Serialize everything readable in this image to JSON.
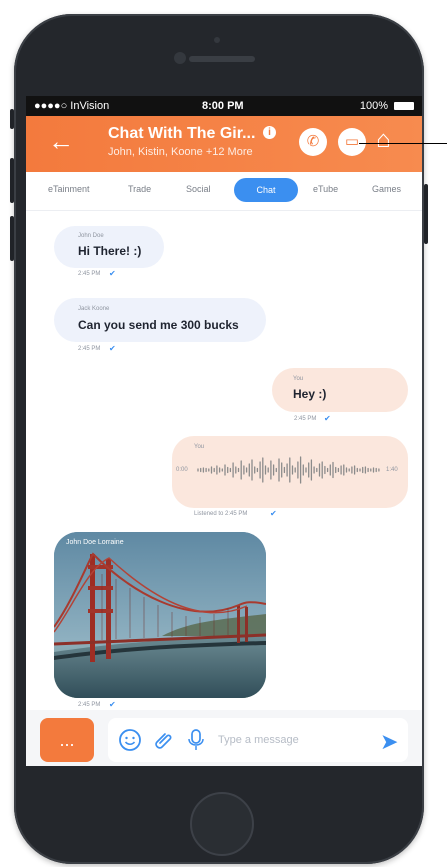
{
  "status": {
    "carrier": "●●●●○ InVision",
    "time": "8:00 PM",
    "battery": "100%"
  },
  "header": {
    "back": "←",
    "title": "Chat With The Gir...",
    "info": "i",
    "subtitle": "John, Kistin, Koone +12 More",
    "call_icon": "phone-icon",
    "video_icon": "video-icon",
    "home_icon": "home-icon"
  },
  "tabs": [
    "eTainment",
    "Trade",
    "Social",
    "Chat",
    "eTube",
    "Games"
  ],
  "messages": [
    {
      "sender": "John Doe",
      "text": "Hi There! :)",
      "time": "2:45 PM",
      "status": "✔"
    },
    {
      "sender": "Jack Koone",
      "text": "Can you send me 300 bucks",
      "time": "2:45 PM",
      "status": "✔"
    },
    {
      "sender": "You",
      "text": "Hey :)",
      "time": "2:45 PM",
      "status": "✔"
    },
    {
      "sender": "You",
      "voice_start": "0:00",
      "voice_end": "1:40",
      "time": "Listened to 2:45 PM",
      "status": "✔"
    },
    {
      "sender": "John Doe Lorraine",
      "time": "2:45 PM",
      "status": "✔"
    }
  ],
  "input": {
    "more": "...",
    "emoji_icon": "emoji-icon",
    "attach_icon": "paperclip-icon",
    "mic_icon": "microphone-icon",
    "placeholder": "Type a message",
    "send_icon": "send-icon"
  },
  "colors": {
    "accent": "#f37a3d",
    "active_tab": "#3b8ff0",
    "incoming_bubble": "#eef2fb",
    "outgoing_bubble": "#fbe7dd"
  }
}
